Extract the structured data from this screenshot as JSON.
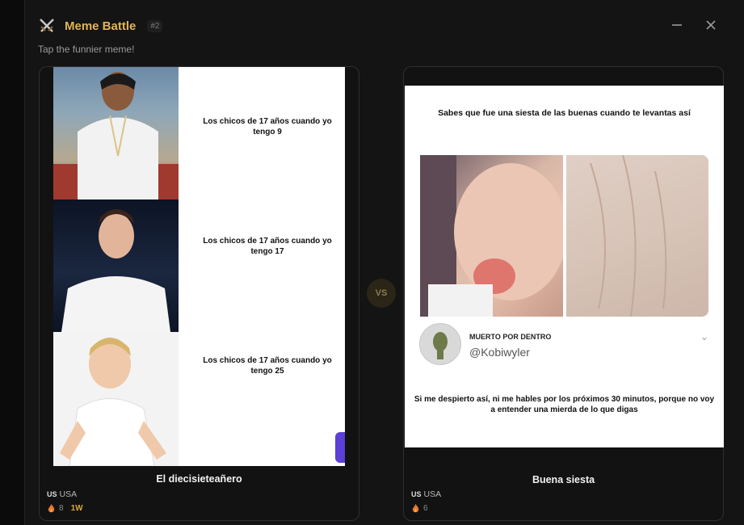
{
  "app": {
    "title": "Meme Battle",
    "round_badge": "#2",
    "subtitle": "Tap the funnier meme!",
    "vs_label": "VS",
    "accent": "#e0b35a"
  },
  "window_controls": {
    "minimize_icon": "minus-icon",
    "close_icon": "close-icon"
  },
  "left_card": {
    "panels": [
      {
        "text": "Los chicos de 17 años cuando yo tengo 9"
      },
      {
        "text": "Los chicos de 17 años cuando yo tengo 17"
      },
      {
        "text": "Los chicos de 17 años cuando yo tengo 25"
      }
    ],
    "caption": "El diecisieteañero",
    "country_code": "US",
    "country": "USA",
    "votes": "8",
    "rank": "1W"
  },
  "right_card": {
    "top_text": "Sabes que fue una siesta de las buenas cuando te levantas así",
    "account_name": "MUERTO POR DENTRO",
    "account_handle": "@Kobiwyler",
    "bottom_text": "Si me despierto así, ni me hables por los próximos 30 minutos, porque no voy a entender una mierda de lo que digas",
    "caption": "Buena siesta",
    "country_code": "US",
    "country": "USA",
    "votes": "6"
  }
}
